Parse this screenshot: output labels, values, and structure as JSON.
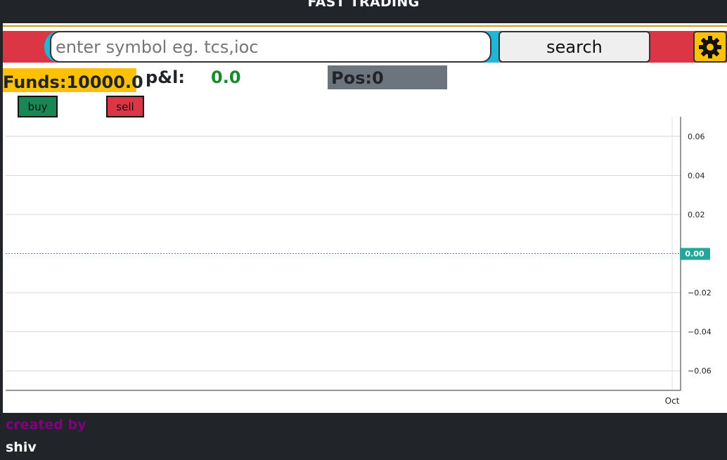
{
  "header": {
    "title": "FAST TRADING"
  },
  "search": {
    "placeholder": "enter symbol eg. tcs,ioc",
    "value": "",
    "button_label": "search"
  },
  "settings": {
    "icon": "gear-icon"
  },
  "stats": {
    "funds_text": "Funds:10000.0",
    "pnl_label": "p&l:",
    "pnl_value": "0.0",
    "pos_text": "Pos:0"
  },
  "actions": {
    "buy_label": "buy",
    "sell_label": "sell"
  },
  "chart_data": {
    "type": "line",
    "series": [],
    "x_tick_labels": [
      "Oct"
    ],
    "y_ticks": [
      0.06,
      0.04,
      0.02,
      0.0,
      -0.02,
      -0.04,
      -0.06
    ],
    "y_tick_labels": [
      "0.06",
      "0.04",
      "0.02",
      "0.00",
      "−0.02",
      "−0.04",
      "−0.06"
    ],
    "ylim": [
      -0.07,
      0.07
    ],
    "current_value_label": "0.00",
    "current_value": 0.0,
    "grid": true,
    "colors": {
      "grid": "#d6d6d6",
      "axis": "#333333",
      "current_line": "#26a69a",
      "current_badge": "#26a69a"
    }
  },
  "footer": {
    "created_label": "created by",
    "author": "shiv"
  },
  "colors": {
    "header_bg": "#212529",
    "search_bar_bg": "#dc3545",
    "accent_cyan": "#1fb6d8",
    "funds_bg": "#ffc107",
    "pnl_value": "#198a2b",
    "pos_bg": "#6c757d",
    "buy_bg": "#198754",
    "sell_bg": "#dc3545",
    "footer_created": "#800080"
  }
}
